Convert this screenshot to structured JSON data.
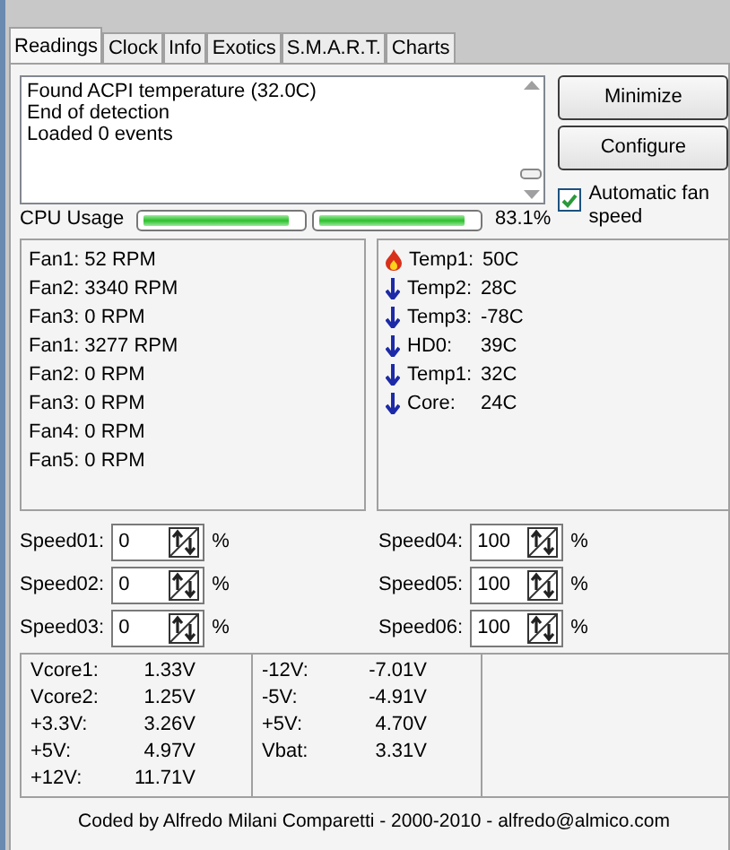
{
  "tabs": [
    {
      "label": "Readings",
      "selected": true
    },
    {
      "label": "Clock",
      "selected": false
    },
    {
      "label": "Info",
      "selected": false
    },
    {
      "label": "Exotics",
      "selected": false
    },
    {
      "label": "S.M.A.R.T.",
      "selected": false
    },
    {
      "label": "Charts",
      "selected": false
    }
  ],
  "log": [
    "Found ACPI temperature (32.0C)",
    "End of detection",
    "Loaded 0 events"
  ],
  "buttons": [
    "Minimize",
    "Configure"
  ],
  "auto_fan_speed": {
    "label": "Automatic fan speed",
    "checked": true
  },
  "cpu_usage": {
    "label": "CPU Usage",
    "bars": [
      {
        "level": 0.93
      },
      {
        "level": 0.93
      }
    ],
    "reading": "83.1%"
  },
  "fans": [
    "Fan1: 52 RPM",
    "Fan2: 3340 RPM",
    "Fan3: 0 RPM",
    "Fan1: 3277 RPM",
    "Fan2: 0 RPM",
    "Fan3: 0 RPM",
    "Fan4: 0 RPM",
    "Fan5: 0 RPM"
  ],
  "temperatures": [
    {
      "label": "Temp1:",
      "value": "50C",
      "kind": "hot"
    },
    {
      "label": "Temp2:",
      "value": "28C",
      "kind": "cool"
    },
    {
      "label": "Temp3:",
      "value": "-78C",
      "kind": "cool"
    },
    {
      "label": "HD0:",
      "value": "39C",
      "kind": "cool"
    },
    {
      "label": "Temp1:",
      "value": "32C",
      "kind": "cool"
    },
    {
      "label": "Core:",
      "value": "24C",
      "kind": "cool"
    }
  ],
  "speeds": [
    {
      "label": "Speed01:",
      "value": "0",
      "unit": "%"
    },
    {
      "label": "Speed02:",
      "value": "0",
      "unit": "%"
    },
    {
      "label": "Speed03:",
      "value": "0",
      "unit": "%"
    },
    {
      "label": "Speed04:",
      "value": "100",
      "unit": "%"
    },
    {
      "label": "Speed05:",
      "value": "100",
      "unit": "%"
    },
    {
      "label": "Speed06:",
      "value": "100",
      "unit": "%"
    }
  ],
  "voltages": [
    [
      {
        "label": "Vcore1:",
        "value": "1.33V"
      },
      {
        "label": "Vcore2:",
        "value": "1.25V"
      },
      {
        "label": "+3.3V:",
        "value": "3.26V"
      },
      {
        "label": "+5V:",
        "value": "4.97V"
      },
      {
        "label": "+12V:",
        "value": "11.71V"
      }
    ],
    [
      {
        "label": "-12V:",
        "value": "-7.01V"
      },
      {
        "label": "-5V:",
        "value": "-4.91V"
      },
      {
        "label": "+5V:",
        "value": "4.70V"
      },
      {
        "label": "Vbat:",
        "value": "3.31V"
      }
    ]
  ],
  "footer": "Coded by Alfredo Milani Comparetti - 2000-2010 - alfredo@almico.com"
}
